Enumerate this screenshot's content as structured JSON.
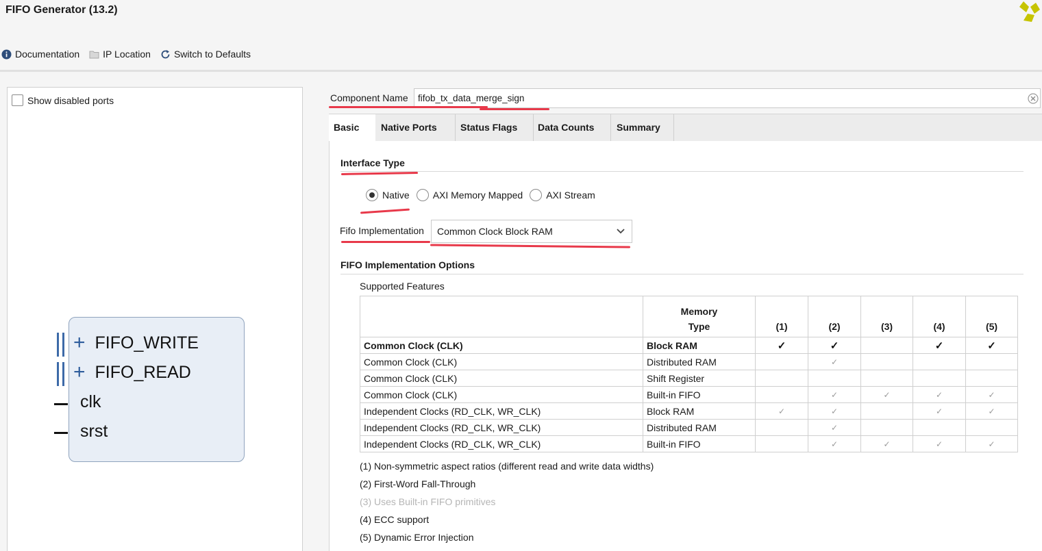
{
  "app": {
    "title": "FIFO Generator (13.2)"
  },
  "toolbar": {
    "documentation": "Documentation",
    "ip_location": "IP Location",
    "switch_defaults": "Switch to Defaults"
  },
  "left": {
    "show_disabled_ports": "Show disabled ports",
    "ports": {
      "fifo_write": "FIFO_WRITE",
      "fifo_read": "FIFO_READ",
      "clk": "clk",
      "srst": "srst"
    }
  },
  "component": {
    "label": "Component Name",
    "value": "fifob_tx_data_merge_sign"
  },
  "tabs": {
    "basic": "Basic",
    "native_ports": "Native Ports",
    "status_flags": "Status Flags",
    "data_counts": "Data Counts",
    "summary": "Summary"
  },
  "interface": {
    "title": "Interface Type",
    "native": "Native",
    "axi_mm": "AXI Memory Mapped",
    "axi_stream": "AXI Stream",
    "selected": "Native"
  },
  "impl": {
    "label": "Fifo Implementation",
    "value": "Common Clock Block RAM"
  },
  "options": {
    "title": "FIFO Implementation Options",
    "supported": "Supported Features",
    "header": {
      "memory_type_1": "Memory",
      "memory_type_2": "Type",
      "c1": "(1)",
      "c2": "(2)",
      "c3": "(3)",
      "c4": "(4)",
      "c5": "(5)"
    },
    "rows": [
      {
        "clock": "Common Clock (CLK)",
        "mem": "Block RAM",
        "f": [
          "✓",
          "✓",
          "",
          "✓",
          "✓"
        ]
      },
      {
        "clock": "Common Clock (CLK)",
        "mem": "Distributed RAM",
        "f": [
          "",
          "✓",
          "",
          "",
          ""
        ]
      },
      {
        "clock": "Common Clock (CLK)",
        "mem": "Shift Register",
        "f": [
          "",
          "",
          "",
          "",
          ""
        ]
      },
      {
        "clock": "Common Clock (CLK)",
        "mem": "Built-in FIFO",
        "f": [
          "",
          "✓",
          "✓",
          "✓",
          "✓"
        ]
      },
      {
        "clock": "Independent Clocks (RD_CLK, WR_CLK)",
        "mem": "Block RAM",
        "f": [
          "✓",
          "✓",
          "",
          "✓",
          "✓"
        ]
      },
      {
        "clock": "Independent Clocks (RD_CLK, WR_CLK)",
        "mem": "Distributed RAM",
        "f": [
          "",
          "✓",
          "",
          "",
          ""
        ]
      },
      {
        "clock": "Independent Clocks (RD_CLK, WR_CLK)",
        "mem": "Built-in FIFO",
        "f": [
          "",
          "✓",
          "✓",
          "✓",
          "✓"
        ]
      }
    ],
    "notes": {
      "n1": "(1) Non-symmetric aspect ratios (different read and write data widths)",
      "n2": "(2) First-Word Fall-Through",
      "n3": "(3) Uses Built-in FIFO primitives",
      "n4": "(4) ECC support",
      "n5": "(5) Dynamic Error Injection"
    }
  },
  "colors": {
    "annotation_red": "#e8394a",
    "ip_block_fill": "#e8eef6",
    "bus_blue": "#3d6aa8"
  }
}
